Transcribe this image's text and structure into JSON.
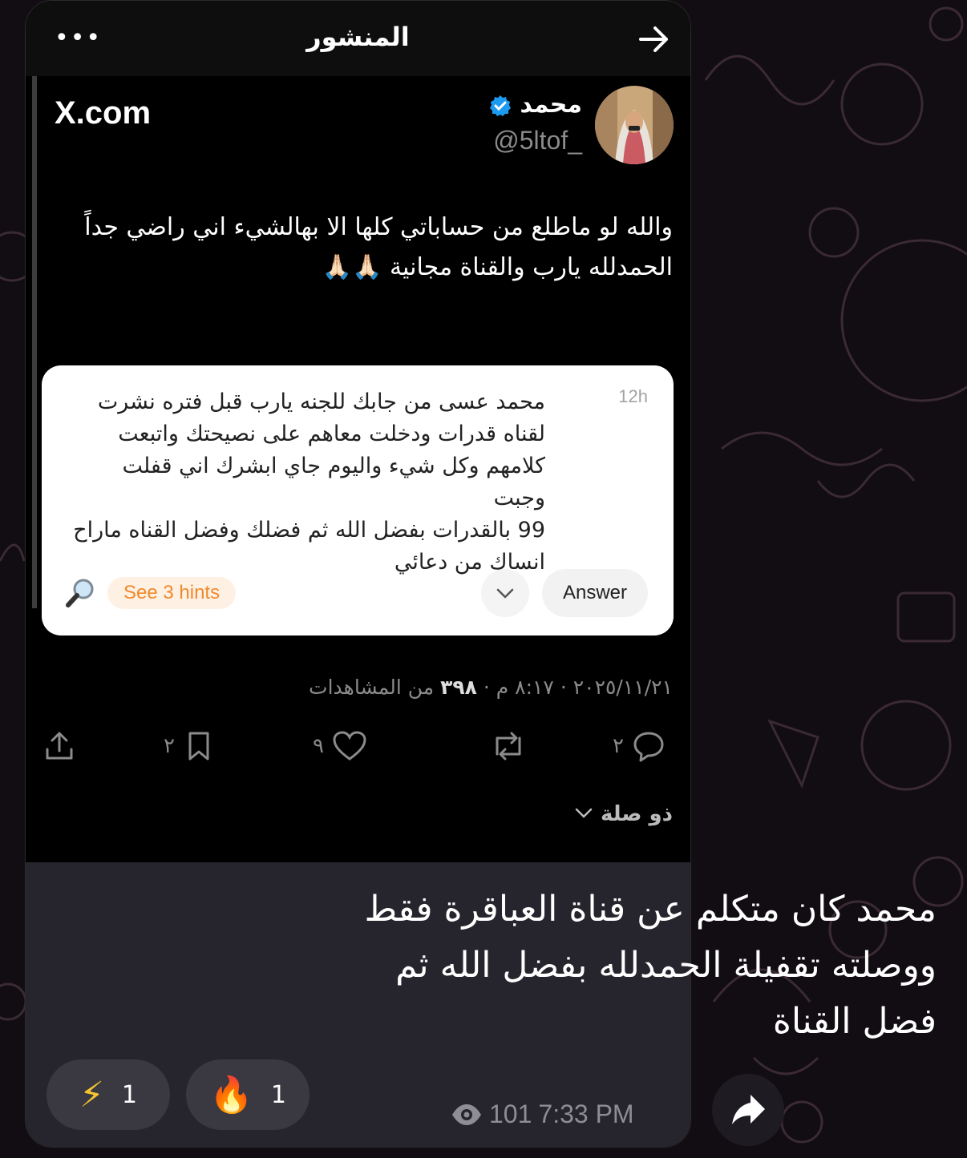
{
  "header": {
    "title": "المنشور",
    "more_icon": "more-icon",
    "forward_icon": "arrow-right-icon"
  },
  "tweet": {
    "site": "X.com",
    "name": "محمد",
    "handle": "@5ltof_",
    "text_lines": [
      "والله لو ماطلع من حساباتي كلها الا بهالشيء اني راضي جداً",
      "الحمدلله يارب والقناة مجانية 🙏🏻🙏🏻"
    ]
  },
  "question_card": {
    "time": "12h",
    "text_lines": [
      "محمد عسى من جابك للجنه يارب قبل فتره نشرت",
      "لقناه قدرات ودخلت معاهم على نصيحتك واتبعت",
      "كلامهم وكل شيء واليوم جاي ابشرك اني قفلت وجبت",
      "99 بالقدرات بفضل الله ثم فضلك وفضل القناه ماراح",
      "انساك من دعائي"
    ],
    "hints_label": "See 3 hints",
    "answer_label": "Answer"
  },
  "meta": {
    "date": "٢٠٢٥/١١/٢١",
    "time": "٨:١٧ م",
    "views_count": "٣٩٨",
    "views_label": "من المشاهدات",
    "sep": " · "
  },
  "actions": {
    "replies": "٢",
    "likes": "٩",
    "bookmarks": "٢"
  },
  "related": {
    "label": "ذو صلة"
  },
  "message": {
    "caption_lines": [
      "محمد كان متكلم عن قناة العباقرة فقط",
      "ووصلته تقفيلة الحمدلله بفضل الله ثم",
      "فضل القناة"
    ],
    "reactions": [
      {
        "emoji": "⚡",
        "count": "1"
      },
      {
        "emoji": "🔥",
        "count": "1"
      }
    ],
    "views": "101",
    "time": "7:33 PM"
  },
  "colors": {
    "accent_blue": "#1d9bf0",
    "hint_orange": "#f08a2c",
    "bubble_bg": "#26252d"
  }
}
